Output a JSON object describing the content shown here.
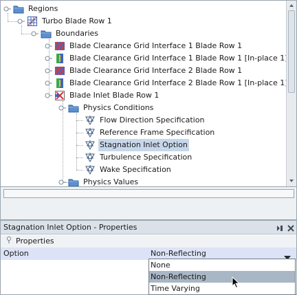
{
  "tree": {
    "nodes": [
      {
        "label": "Regions",
        "icon": "folder-icon"
      },
      {
        "label": "Turbo Blade Row 1",
        "icon": "mesh-region-icon"
      },
      {
        "label": "Boundaries",
        "icon": "folder-icon"
      },
      {
        "label": "Blade Clearance Grid Interface 1 Blade Row 1",
        "icon": "interface-boundary-icon"
      },
      {
        "label": "Blade Clearance Grid Interface 1 Blade Row 1 [In-place 1]",
        "icon": "in-place-boundary-icon"
      },
      {
        "label": "Blade Clearance Grid Interface 2 Blade Row 1",
        "icon": "interface-boundary-icon"
      },
      {
        "label": "Blade Clearance Grid Interface 2 Blade Row 1 [In-place 1]",
        "icon": "in-place-boundary-icon"
      },
      {
        "label": "Blade Inlet Blade Row 1",
        "icon": "inlet-boundary-icon"
      },
      {
        "label": "Physics Conditions",
        "icon": "folder-icon"
      },
      {
        "label": "Flow Direction Specification",
        "icon": "physics-condition-icon"
      },
      {
        "label": "Reference Frame Specification",
        "icon": "physics-condition-icon"
      },
      {
        "label": "Stagnation Inlet Option",
        "icon": "physics-condition-icon"
      },
      {
        "label": "Turbulence Specification",
        "icon": "physics-condition-icon"
      },
      {
        "label": "Wake Specification",
        "icon": "physics-condition-icon"
      },
      {
        "label": "Physics Values",
        "icon": "folder-icon"
      }
    ],
    "selected": "Stagnation Inlet Option"
  },
  "properties": {
    "title": "Stagnation Inlet Option - Properties",
    "section": "Properties",
    "row": {
      "key": "Option",
      "value": "Non-Reflecting"
    },
    "options": [
      "None",
      "Non-Reflecting",
      "Time Varying"
    ],
    "hovered_option": "Non-Reflecting"
  },
  "colors": {
    "selection": "#c7d7ea",
    "row_highlight": "#dde3f6",
    "hover": "#a8b6c6",
    "folder": "#5b8fd0"
  }
}
